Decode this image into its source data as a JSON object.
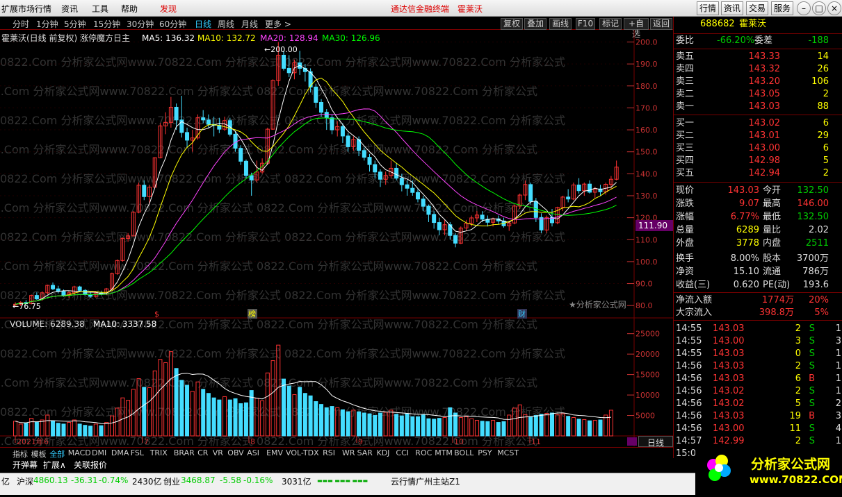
{
  "topbar": {
    "menu": [
      "扩展市场行情",
      "资讯",
      "工具",
      "帮助",
      "发现"
    ],
    "center": "通达信金融终端",
    "stock": "霍莱沃",
    "buttons": [
      "行情",
      "资讯",
      "交易",
      "服务"
    ]
  },
  "periods": [
    "分时",
    "1分钟",
    "5分钟",
    "15分钟",
    "30分钟",
    "60分钟",
    "日线",
    "周线",
    "月线",
    "更多 >"
  ],
  "tools": [
    "复权",
    "叠加",
    "画线",
    "F10",
    "标记",
    "+自选",
    "返回"
  ],
  "chart_info": {
    "title": "霍莱沃(日线 前复权) 涨停魔方日主",
    "ma5": "MA5: 136.32",
    "ma10": "MA10: 132.72",
    "ma20": "MA20: 128.94",
    "ma30": "MA30: 126.96",
    "high_label": "200.00",
    "low_label": "76.75",
    "price_tag": "111.90",
    "watermark": "★分析家公式网",
    "wm": "0822.Com  分析家公式网www.70822.Com  分析家公式",
    "marks": [
      "$",
      "榜",
      "财"
    ]
  },
  "vol_info": {
    "vol": "VOLUME: 6289.38",
    "ma10": "MA10: 3337.58"
  },
  "months": [
    "2021年6",
    "7",
    "8",
    "9",
    "10",
    "11"
  ],
  "chart_data": [
    {
      "type": "candlestick",
      "name": "霍莱沃",
      "y_axis": [
        "200.0",
        "190.0",
        "180.0",
        "170.0",
        "160.0",
        "150.0",
        "140.0",
        "130.0",
        "120.0",
        "110.0",
        "100.0",
        "90.0",
        "80.0"
      ],
      "ylim": [
        75,
        203
      ],
      "ohlc": [
        [
          80.5,
          81.5,
          79.5,
          80.6
        ],
        [
          80.6,
          82.0,
          79.8,
          81.4
        ],
        [
          81.4,
          82.5,
          80.5,
          80.9
        ],
        [
          80.9,
          85.0,
          80.5,
          84.6
        ],
        [
          84.6,
          86.0,
          82.6,
          83.0
        ],
        [
          83.0,
          86.5,
          82.2,
          85.8
        ],
        [
          85.8,
          89.5,
          85.2,
          89.2
        ],
        [
          89.2,
          90.5,
          87.0,
          87.6
        ],
        [
          87.6,
          89.0,
          85.5,
          86.4
        ],
        [
          86.4,
          87.3,
          84.0,
          84.6
        ],
        [
          84.6,
          86.5,
          83.5,
          85.8
        ],
        [
          85.8,
          89.0,
          85.0,
          88.5
        ],
        [
          88.5,
          89.0,
          86.5,
          86.9
        ],
        [
          86.9,
          87.5,
          84.6,
          85.0
        ],
        [
          85.0,
          86.2,
          83.5,
          84.2
        ],
        [
          84.2,
          86.2,
          83.6,
          85.7
        ],
        [
          85.7,
          86.5,
          84.6,
          85.2
        ],
        [
          85.2,
          88.0,
          84.8,
          87.6
        ],
        [
          87.6,
          95.0,
          87.0,
          94.5
        ],
        [
          94.5,
          101.0,
          94.0,
          100.5
        ],
        [
          100.5,
          111.0,
          100.0,
          110.6
        ],
        [
          110.6,
          113.0,
          109.0,
          111.7
        ],
        [
          111.7,
          123.0,
          111.5,
          122.5
        ],
        [
          122.5,
          136.0,
          122.0,
          134.8
        ],
        [
          134.8,
          137.0,
          128.0,
          129.6
        ],
        [
          129.6,
          135.0,
          126.0,
          133.9
        ],
        [
          133.9,
          147.5,
          133.5,
          147.3
        ],
        [
          147.3,
          163.0,
          147.0,
          161.8
        ],
        [
          161.8,
          168.0,
          158.0,
          163.4
        ],
        [
          163.4,
          175.0,
          161.0,
          170.3
        ],
        [
          170.3,
          172.0,
          160.0,
          164.5
        ],
        [
          164.5,
          175.5,
          156.5,
          158.8
        ],
        [
          158.8,
          161.0,
          152.0,
          155.3
        ],
        [
          155.3,
          160.0,
          150.0,
          156.3
        ],
        [
          156.3,
          167.0,
          155.5,
          165.5
        ],
        [
          165.5,
          169.0,
          163.0,
          164.5
        ],
        [
          164.5,
          167.0,
          161.0,
          162.5
        ],
        [
          162.5,
          166.0,
          157.0,
          162.1
        ],
        [
          162.1,
          165.5,
          158.5,
          160.3
        ],
        [
          160.3,
          166.0,
          159.5,
          164.2
        ],
        [
          164.2,
          165.5,
          157.0,
          158.0
        ],
        [
          158.0,
          159.5,
          150.0,
          151.6
        ],
        [
          151.6,
          153.0,
          144.0,
          145.7
        ],
        [
          145.7,
          146.5,
          138.0,
          139.2
        ],
        [
          139.2,
          140.5,
          130.0,
          137.2
        ],
        [
          137.2,
          146.0,
          136.0,
          140.8
        ],
        [
          140.8,
          147.0,
          140.0,
          144.8
        ],
        [
          144.8,
          161.0,
          144.0,
          160.3
        ],
        [
          160.3,
          183.0,
          160.0,
          182.5
        ],
        [
          182.5,
          200.0,
          180.0,
          194.0
        ],
        [
          194.0,
          196.0,
          187.0,
          188.0
        ],
        [
          188.0,
          194.0,
          184.0,
          186.0
        ],
        [
          186.0,
          192.0,
          183.0,
          190.5
        ],
        [
          190.5,
          196.0,
          185.0,
          188.0
        ],
        [
          188.0,
          190.0,
          182.0,
          186.5
        ],
        [
          186.5,
          188.0,
          177.0,
          179.5
        ],
        [
          179.5,
          181.0,
          170.0,
          172.5
        ],
        [
          172.5,
          174.0,
          166.0,
          168.0
        ],
        [
          168.0,
          169.5,
          160.0,
          165.5
        ],
        [
          165.5,
          167.0,
          158.0,
          160.0
        ],
        [
          160.0,
          164.0,
          157.0,
          161.5
        ],
        [
          161.5,
          163.0,
          154.0,
          157.2
        ],
        [
          157.2,
          158.5,
          150.0,
          152.3
        ],
        [
          152.3,
          157.0,
          150.5,
          155.6
        ],
        [
          155.6,
          157.0,
          148.0,
          150.6
        ],
        [
          150.6,
          152.0,
          146.0,
          147.5
        ],
        [
          147.5,
          149.0,
          141.0,
          144.2
        ],
        [
          144.2,
          146.0,
          138.0,
          140.8
        ],
        [
          140.8,
          142.0,
          134.0,
          137.5
        ],
        [
          137.5,
          141.0,
          135.0,
          139.2
        ],
        [
          139.2,
          146.0,
          138.0,
          142.5
        ],
        [
          142.5,
          145.0,
          137.0,
          138.0
        ],
        [
          138.0,
          140.0,
          132.0,
          135.0
        ],
        [
          135.0,
          137.0,
          130.0,
          133.4
        ],
        [
          133.4,
          137.0,
          130.0,
          131.5
        ],
        [
          131.5,
          133.0,
          127.0,
          128.5
        ],
        [
          128.5,
          130.0,
          123.0,
          125.2
        ],
        [
          125.2,
          126.0,
          118.0,
          121.5
        ],
        [
          121.5,
          123.0,
          115.0,
          117.8
        ],
        [
          117.8,
          120.0,
          112.0,
          114.5
        ],
        [
          114.5,
          119.0,
          112.0,
          116.8
        ],
        [
          116.8,
          118.0,
          110.0,
          111.9
        ],
        [
          111.9,
          113.0,
          106.5,
          108.4
        ],
        [
          108.4,
          116.0,
          108.0,
          115.3
        ],
        [
          115.3,
          119.0,
          114.0,
          117.5
        ],
        [
          117.5,
          121.0,
          116.0,
          119.9
        ],
        [
          119.9,
          123.0,
          118.0,
          121.2
        ],
        [
          121.2,
          123.0,
          118.0,
          119.3
        ],
        [
          119.3,
          121.0,
          116.0,
          117.9
        ],
        [
          117.9,
          120.0,
          116.0,
          119.5
        ],
        [
          119.5,
          121.0,
          117.0,
          118.5
        ],
        [
          118.5,
          120.0,
          115.5,
          116.3
        ],
        [
          116.3,
          118.0,
          114.0,
          117.6
        ],
        [
          117.6,
          126.0,
          117.0,
          125.3
        ],
        [
          125.3,
          131.0,
          124.0,
          130.3
        ],
        [
          130.3,
          137.0,
          128.0,
          135.1
        ],
        [
          135.1,
          136.0,
          126.0,
          127.4
        ],
        [
          127.4,
          129.0,
          118.0,
          120.1
        ],
        [
          120.1,
          122.0,
          113.0,
          114.4
        ],
        [
          114.4,
          121.0,
          113.0,
          120.1
        ],
        [
          120.1,
          124.0,
          116.0,
          117.7
        ],
        [
          117.7,
          125.0,
          117.0,
          124.7
        ],
        [
          124.7,
          130.0,
          123.0,
          129.4
        ],
        [
          129.4,
          133.0,
          127.0,
          128.5
        ],
        [
          128.5,
          136.0,
          128.0,
          134.9
        ],
        [
          134.9,
          138.0,
          131.0,
          132.3
        ],
        [
          132.3,
          136.0,
          130.0,
          135.3
        ],
        [
          135.3,
          137.0,
          131.0,
          131.6
        ],
        [
          131.6,
          134.0,
          129.0,
          133.1
        ],
        [
          133.1,
          135.0,
          130.0,
          131.8
        ],
        [
          131.8,
          136.0,
          130.5,
          135.2
        ],
        [
          135.2,
          139.0,
          133.0,
          137.5
        ],
        [
          137.5,
          146.0,
          137.0,
          143.03
        ]
      ]
    },
    {
      "type": "line",
      "name": "MA",
      "series": [
        {
          "name": "MA5",
          "color": "#ffffff"
        },
        {
          "name": "MA10",
          "color": "#ffff00"
        },
        {
          "name": "MA20",
          "color": "#ff44ff"
        },
        {
          "name": "MA30",
          "color": "#00ff00"
        }
      ]
    },
    {
      "type": "bar",
      "name": "VOLUME",
      "y_axis": [
        "25000",
        "20000",
        "15000",
        "10000",
        "5000"
      ],
      "ylim": [
        0,
        28000
      ],
      "values": [
        3600,
        2900,
        3100,
        4300,
        3400,
        3900,
        5100,
        3600,
        3100,
        2900,
        3300,
        3900,
        2900,
        2600,
        2400,
        2900,
        2500,
        3300,
        4900,
        6800,
        9300,
        8700,
        11400,
        14000,
        11900,
        11800,
        15900,
        18700,
        17900,
        20600,
        16500,
        13600,
        12400,
        10900,
        13200,
        11400,
        10400,
        9300,
        8800,
        9600,
        8800,
        9100,
        7900,
        8100,
        11100,
        9200,
        8600,
        15400,
        18400,
        22200,
        13900,
        12200,
        10100,
        11900,
        10400,
        9800,
        8400,
        7700,
        6900,
        7200,
        6900,
        6400,
        5900,
        6300,
        5900,
        5600,
        5400,
        5000,
        5600,
        5800,
        6300,
        5300,
        4900,
        5400,
        4700,
        4700,
        5100,
        4200,
        4100,
        4300,
        4500,
        6900,
        5600,
        4500,
        4700,
        4200,
        3800,
        3600,
        3500,
        3800,
        3300,
        3500,
        5100,
        6800,
        7600,
        5200,
        4700,
        5000,
        5300,
        5500,
        5600,
        5200,
        5400,
        4800,
        4500,
        4100,
        4000,
        3700,
        3800,
        3900,
        5100,
        6289
      ]
    }
  ],
  "right": {
    "code": "688682",
    "name": "霍莱沃",
    "weibi": [
      "委比",
      "-66.20%",
      "委差",
      "-188"
    ],
    "sell": [
      [
        "卖五",
        "143.33",
        "14"
      ],
      [
        "卖四",
        "143.32",
        "26"
      ],
      [
        "卖三",
        "143.20",
        "106"
      ],
      [
        "卖二",
        "143.05",
        "2"
      ],
      [
        "卖一",
        "143.03",
        "88"
      ]
    ],
    "buy": [
      [
        "买一",
        "143.02",
        "6"
      ],
      [
        "买二",
        "143.01",
        "29"
      ],
      [
        "买三",
        "143.00",
        "6"
      ],
      [
        "买四",
        "142.98",
        "5"
      ],
      [
        "买五",
        "142.94",
        "2"
      ]
    ],
    "stats": [
      [
        "现价",
        "143.03",
        "今开",
        "132.50"
      ],
      [
        "涨跌",
        "9.07",
        "最高",
        "146.00"
      ],
      [
        "涨幅",
        "6.77%",
        "最低",
        "132.50"
      ],
      [
        "总量",
        "6289",
        "量比",
        "2.02"
      ],
      [
        "外盘",
        "3778",
        "内盘",
        "2511"
      ],
      [
        "换手",
        "8.00%",
        "股本",
        "3700万"
      ],
      [
        "净资",
        "15.10",
        "流通",
        "786万"
      ],
      [
        "收益(三)",
        "0.620",
        "PE(动)",
        "193.6"
      ]
    ],
    "flow": [
      [
        "净流入额",
        "1774万",
        "20%"
      ],
      [
        "大宗流入",
        "398.8万",
        "5%"
      ]
    ],
    "ticks": [
      [
        "14:55",
        "143.03",
        "2",
        "S",
        "1"
      ],
      [
        "14:55",
        "143.00",
        "3",
        "S",
        "3"
      ],
      [
        "14:55",
        "143.03",
        "0",
        "S",
        "1"
      ],
      [
        "14:56",
        "143.03",
        "2",
        "S",
        "1"
      ],
      [
        "14:56",
        "143.03",
        "6",
        "B",
        "1"
      ],
      [
        "14:56",
        "143.02",
        "2",
        "S",
        "1"
      ],
      [
        "14:56",
        "143.02",
        "5",
        "S",
        "2"
      ],
      [
        "14:56",
        "143.03",
        "19",
        "B",
        "3"
      ],
      [
        "14:56",
        "143.00",
        "11",
        "S",
        "4"
      ],
      [
        "14:57",
        "142.99",
        "2",
        "S",
        "1"
      ],
      [
        "15:0",
        "",
        "",
        "",
        ""
      ]
    ]
  },
  "indicators": [
    "指标",
    "模板",
    "全部",
    "MACD",
    "DMI",
    "DMA",
    "FSL",
    "TRIX",
    "BRAR",
    "CR",
    "VR",
    "OBV",
    "ASI",
    "EMV",
    "VOL-TDX",
    "RSI",
    "WR",
    "SAR",
    "KDJ",
    "CCI",
    "ROC",
    "MTM",
    "BOLL",
    "PSY",
    "MCST"
  ],
  "tab_day": "日线",
  "bottom_tabs": [
    "开弹幕",
    "扩展∧",
    "关联报价"
  ],
  "status": {
    "a": "亿",
    "b": "沪深",
    "c": "4860.13",
    "d": "-36.31",
    "e": "-0.74%",
    "f": "2430亿",
    "g": "创业",
    "h": "3468.87",
    "i": "-5.58",
    "j": "-0.16%",
    "k": "3031亿",
    "l": "云行情广州主站Z1"
  },
  "logo": {
    "t1": "分析家公式网",
    "t2": "www.70822.COM"
  }
}
